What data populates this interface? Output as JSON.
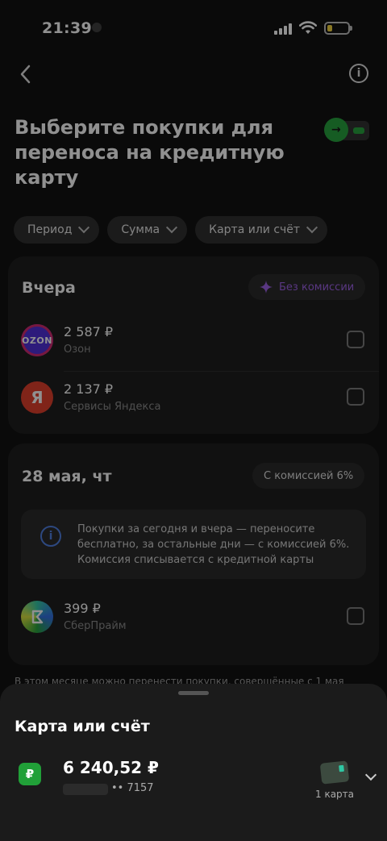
{
  "status_bar": {
    "time": "21:39"
  },
  "page": {
    "title": "Выберите покупки для переноса на кредитную карту"
  },
  "filters": [
    {
      "label": "Период"
    },
    {
      "label": "Сумма"
    },
    {
      "label": "Карта или счёт"
    }
  ],
  "groups": [
    {
      "title": "Вчера",
      "badge": "Без комиссии",
      "items": [
        {
          "logo_text": "OZON",
          "amount": "2 587 ₽",
          "merchant": "Озон",
          "checked": false
        },
        {
          "logo_text": "Я",
          "amount": "2 137 ₽",
          "merchant": "Сервисы Яндекса",
          "checked": false
        }
      ]
    },
    {
      "title": "28 мая, чт",
      "badge": "С комиссией 6%",
      "info": "Покупки за сегодня и вчера — переносите бесплатно, за остальные дни — с комиссией 6%. Комиссия списывается с кредитной карты",
      "items": [
        {
          "logo_text": "",
          "amount": "399 ₽",
          "merchant": "СберПрайм",
          "checked": false
        }
      ]
    }
  ],
  "footnote": "В этом месяце можно перенести покупки, совершённые с 1 мая",
  "sheet": {
    "title": "Карта или счёт",
    "currency_icon": "₽",
    "balance": "6 240,52 ₽",
    "account_suffix": "•• 7157",
    "cards_count": "1 карта"
  },
  "colors": {
    "accent_green": "#21a038",
    "purple": "#9b5de5",
    "info_blue": "#4b7be0"
  }
}
